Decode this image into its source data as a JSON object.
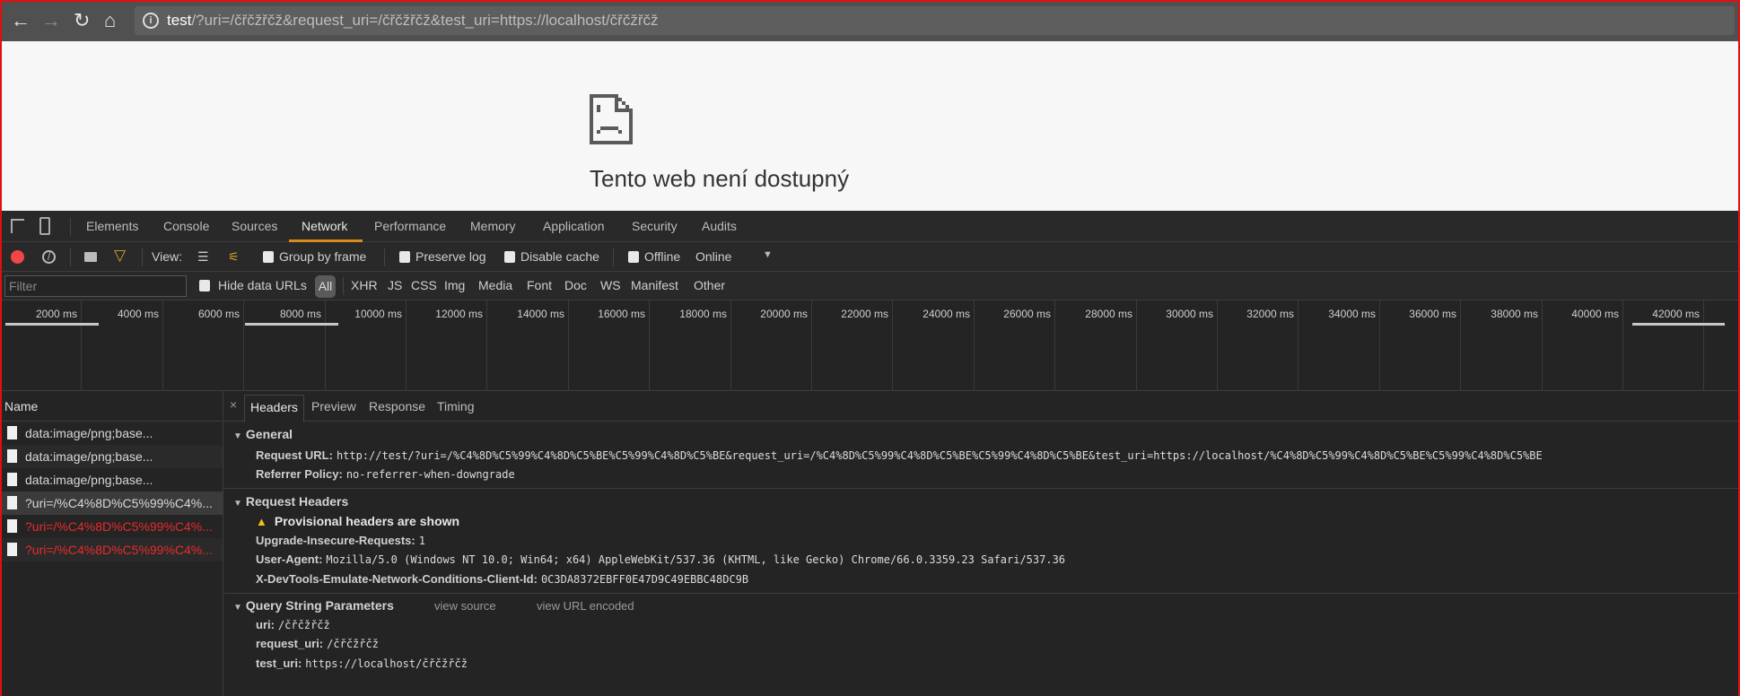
{
  "browser": {
    "url_host": "test",
    "url_rest": "/?uri=/čřčžřčž&request_uri=/čřčžřčž&test_uri=https://localhost/čřčžřčž"
  },
  "page": {
    "error_title": "Tento web není dostupný"
  },
  "devtools": {
    "tabs": [
      "Elements",
      "Console",
      "Sources",
      "Network",
      "Performance",
      "Memory",
      "Application",
      "Security",
      "Audits"
    ],
    "active_tab": "Network",
    "toolbar": {
      "view_label": "View:",
      "group_by_frame": "Group by frame",
      "preserve_log": "Preserve log",
      "disable_cache": "Disable cache",
      "offline": "Offline",
      "throttle": "Online"
    },
    "filter": {
      "placeholder": "Filter",
      "hide_data_urls": "Hide data URLs",
      "types": [
        "All",
        "XHR",
        "JS",
        "CSS",
        "Img",
        "Media",
        "Font",
        "Doc",
        "WS",
        "Manifest",
        "Other"
      ]
    },
    "timeline": {
      "ticks": [
        "2000 ms",
        "4000 ms",
        "6000 ms",
        "8000 ms",
        "10000 ms",
        "12000 ms",
        "14000 ms",
        "16000 ms",
        "18000 ms",
        "20000 ms",
        "22000 ms",
        "24000 ms",
        "26000 ms",
        "28000 ms",
        "30000 ms",
        "32000 ms",
        "34000 ms",
        "36000 ms",
        "38000 ms",
        "40000 ms",
        "42000 ms",
        "4"
      ],
      "requests_ms": [
        [
          0,
          2300
        ],
        [
          5900,
          8200
        ],
        [
          40100,
          42400
        ]
      ]
    },
    "requests": {
      "header": "Name",
      "rows": [
        {
          "name": "data:image/png;base...",
          "status": "ok"
        },
        {
          "name": "data:image/png;base...",
          "status": "ok"
        },
        {
          "name": "data:image/png;base...",
          "status": "ok"
        },
        {
          "name": "?uri=/%C4%8D%C5%99%C4%...",
          "status": "selected"
        },
        {
          "name": "?uri=/%C4%8D%C5%99%C4%...",
          "status": "error"
        },
        {
          "name": "?uri=/%C4%8D%C5%99%C4%...",
          "status": "error"
        }
      ]
    },
    "details": {
      "close": "×",
      "tabs": [
        "Headers",
        "Preview",
        "Response",
        "Timing"
      ],
      "general": {
        "title": "General",
        "request_url_key": "Request URL:",
        "request_url": "http://test/?uri=/%C4%8D%C5%99%C4%8D%C5%BE%C5%99%C4%8D%C5%BE&request_uri=/%C4%8D%C5%99%C4%8D%C5%BE%C5%99%C4%8D%C5%BE&test_uri=https://localhost/%C4%8D%C5%99%C4%8D%C5%BE%C5%99%C4%8D%C5%BE",
        "referrer_key": "Referrer Policy:",
        "referrer": "no-referrer-when-downgrade"
      },
      "request_headers": {
        "title": "Request Headers",
        "warning": "Provisional headers are shown",
        "items": [
          {
            "k": "Upgrade-Insecure-Requests:",
            "v": "1"
          },
          {
            "k": "User-Agent:",
            "v": "Mozilla/5.0 (Windows NT 10.0; Win64; x64) AppleWebKit/537.36 (KHTML, like Gecko) Chrome/66.0.3359.23 Safari/537.36"
          },
          {
            "k": "X-DevTools-Emulate-Network-Conditions-Client-Id:",
            "v": "0C3DA8372EBFF0E47D9C49EBBC48DC9B"
          }
        ]
      },
      "query": {
        "title": "Query String Parameters",
        "view_source": "view source",
        "view_encoded": "view URL encoded",
        "items": [
          {
            "k": "uri:",
            "v": "/čřčžřčž"
          },
          {
            "k": "request_uri:",
            "v": "/čřčžřčž"
          },
          {
            "k": "test_uri:",
            "v": "https://localhost/čřčžřčž"
          }
        ]
      }
    }
  }
}
